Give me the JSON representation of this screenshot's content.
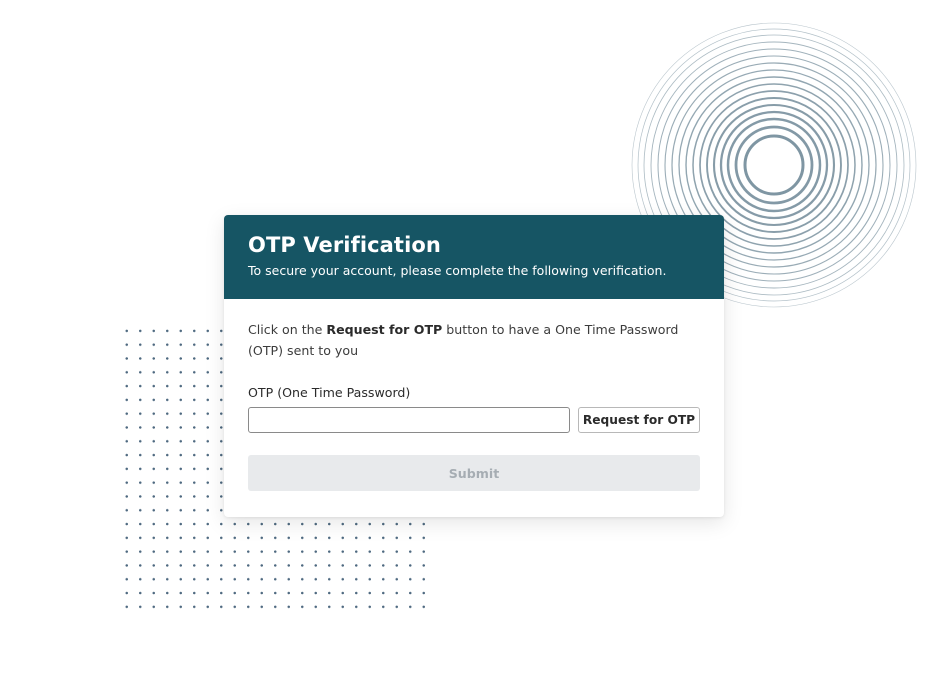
{
  "card": {
    "title": "OTP Verification",
    "subtitle": "To secure your account, please complete the following verification."
  },
  "instruction": {
    "prefix": "Click on the ",
    "emphasis": "Request for OTP",
    "suffix": " button to have a One Time Password (OTP) sent to you"
  },
  "otp": {
    "label": "OTP (One Time Password)",
    "value": "",
    "placeholder": ""
  },
  "buttons": {
    "request_label": "Request for OTP",
    "submit_label": "Submit"
  },
  "colors": {
    "header_bg": "#165564",
    "submit_disabled_bg": "#e8eaec",
    "submit_disabled_text": "#a6adb3",
    "ring_stroke": "#7f96a3",
    "dot_color": "#2f4f6a"
  }
}
